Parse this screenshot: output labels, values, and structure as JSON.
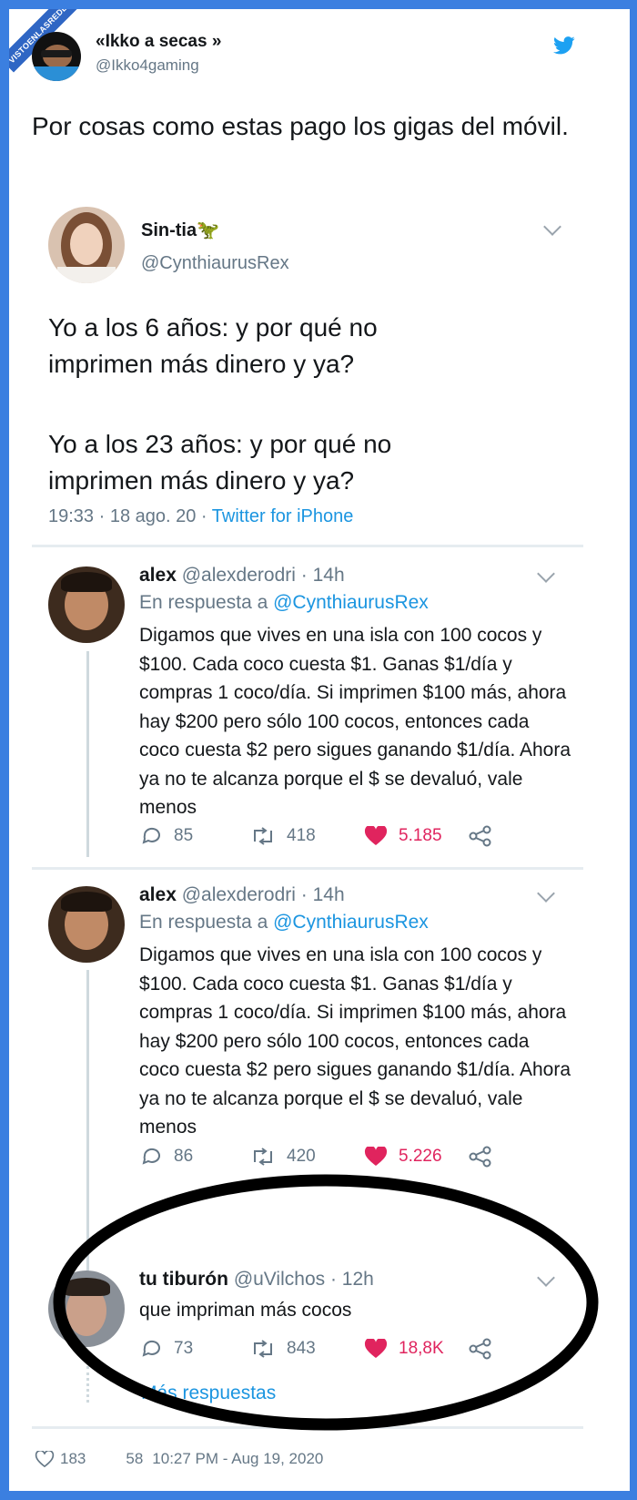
{
  "watermark": "VISTOENLASREDES",
  "outer_tweet": {
    "name": "«Ikko a secas »",
    "handle": "@Ikko4gaming",
    "text": "Por cosas como estas pago los gigas del móvil.",
    "likes": "183",
    "replies": "58",
    "timestamp": "10:27 PM - Aug 19, 2020"
  },
  "quoted_tweet": {
    "name": "Sin-tia",
    "handle": "@CynthiaurusRex",
    "paragraph1": "Yo a los 6 años: y por qué no imprimen más dinero y ya?",
    "paragraph2": "Yo a los 23 años: y por qué no imprimen más dinero y ya?",
    "time": "19:33 · 18 ago. 20 · ",
    "source": "Twitter for iPhone"
  },
  "reply1": {
    "name": "alex",
    "meta": "@alexderodri · 14h",
    "reply_prefix": "En respuesta a ",
    "reply_to": "@CynthiaurusRex",
    "text": "Digamos que vives en una isla con 100 cocos y $100. Cada coco cuesta $1. Ganas $1/día y compras 1 coco/día. Si imprimen $100 más, ahora hay $200 pero sólo 100 cocos, entonces cada coco cuesta $2 pero sigues ganando $1/día. Ahora ya no te alcanza porque el $ se devaluó, vale menos",
    "replies": "85",
    "retweets": "418",
    "likes": "5.185"
  },
  "reply2": {
    "name": "alex",
    "meta": "@alexderodri · 14h",
    "reply_prefix": "En respuesta a ",
    "reply_to": "@CynthiaurusRex",
    "text": "Digamos que vives en una isla con 100 cocos y $100. Cada coco cuesta $1. Ganas $1/día y compras 1 coco/día. Si imprimen $100 más, ahora hay $200 pero sólo 100 cocos, entonces cada coco cuesta $2 pero sigues ganando $1/día. Ahora ya no te alcanza porque el $ se devaluó, vale menos",
    "replies": "86",
    "retweets": "420",
    "likes": "5.226"
  },
  "reply3": {
    "name": "tu tiburón",
    "meta": "@uVilchos · 12h",
    "text": "que impriman más cocos",
    "replies": "73",
    "retweets": "843",
    "likes": "18,8K",
    "more": "Más respuestas"
  },
  "colors": {
    "twitter_blue": "#1da1f2",
    "link_blue": "#1b95e0",
    "like_red": "#e0245e",
    "muted": "#657786",
    "frame_blue": "#3b7fe0"
  }
}
